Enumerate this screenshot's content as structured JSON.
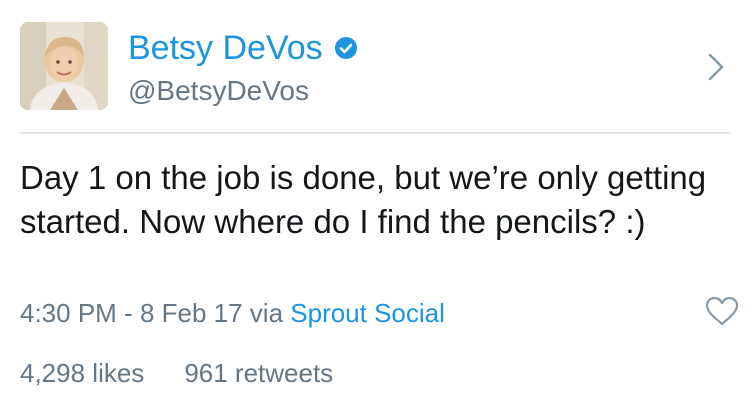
{
  "profile": {
    "display_name": "Betsy DeVos",
    "handle": "@BetsyDeVos",
    "verified": true,
    "avatar_icon": "user-avatar-photo",
    "accent": "#1b95e0"
  },
  "tweet": {
    "text": "Day 1 on the job is done, but we’re only getting started. Now where do I find the pencils? :)",
    "time": "4:30 PM",
    "separator": " - ",
    "date": "8 Feb 17",
    "via_label": " via ",
    "source": "Sprout Social"
  },
  "stats": {
    "likes": "4,298 likes",
    "retweets": "961 retweets"
  },
  "icons": {
    "verified": "verified-badge-icon",
    "chevron": "chevron-right-icon",
    "like": "heart-icon"
  },
  "colors": {
    "text": "#14171a",
    "secondary": "#657786",
    "link": "#1b95e0",
    "divider": "#e1e8ed"
  }
}
